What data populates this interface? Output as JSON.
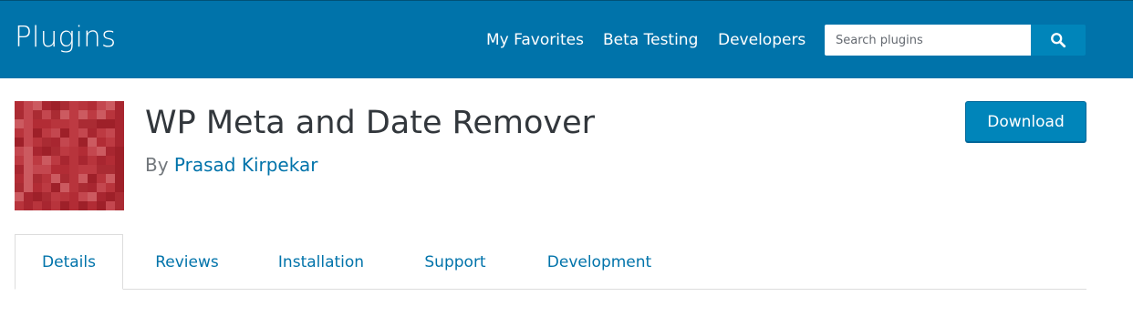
{
  "header": {
    "title": "Plugins",
    "nav": [
      {
        "label": "My Favorites"
      },
      {
        "label": "Beta Testing"
      },
      {
        "label": "Developers"
      }
    ],
    "search": {
      "placeholder": "Search plugins",
      "icon": "search-icon"
    }
  },
  "plugin": {
    "name": "WP Meta and Date Remover",
    "by_prefix": "By",
    "author": "Prasad Kirpekar",
    "download_label": "Download",
    "icon": "plugin-icon"
  },
  "tabs": [
    {
      "label": "Details"
    },
    {
      "label": "Reviews"
    },
    {
      "label": "Installation"
    },
    {
      "label": "Support"
    },
    {
      "label": "Development"
    }
  ],
  "colors": {
    "header_bg": "#0073aa",
    "accent": "#0085ba",
    "link": "#0073aa",
    "title_text": "#32373c",
    "icon_red": "#b22c35"
  }
}
